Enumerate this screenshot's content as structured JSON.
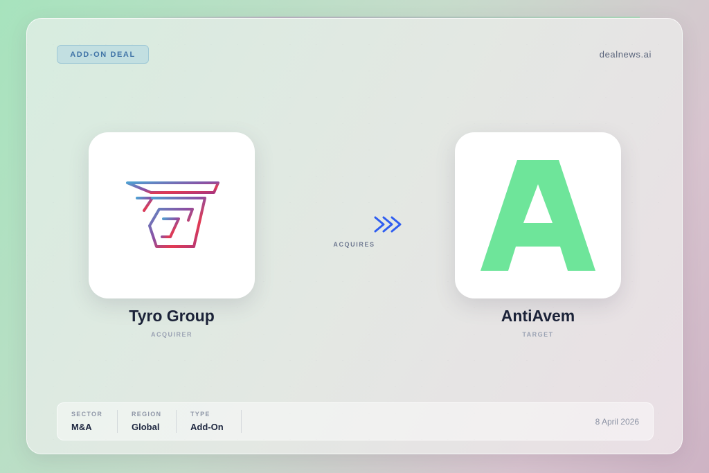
{
  "badge": {
    "label": "ADD-ON DEAL"
  },
  "brand": {
    "name": "dealnews.ai"
  },
  "acquirer": {
    "name": "Tyro Group",
    "role": "ACQUIRER",
    "logo_icon": "tyro-group-logo-icon"
  },
  "target": {
    "name": "AntiAvem",
    "role": "TARGET",
    "logo_icon": "antiavem-logo-icon",
    "logo_letter": "A",
    "logo_color": "#6ee59a"
  },
  "relation": {
    "label": "ACQUIRES",
    "arrow_color": "#2f5ef0"
  },
  "footer": {
    "sector": {
      "label": "SECTOR",
      "value": "M&A"
    },
    "region": {
      "label": "REGION",
      "value": "Global"
    },
    "type": {
      "label": "TYPE",
      "value": "Add-On"
    },
    "date": "8 April 2026"
  }
}
